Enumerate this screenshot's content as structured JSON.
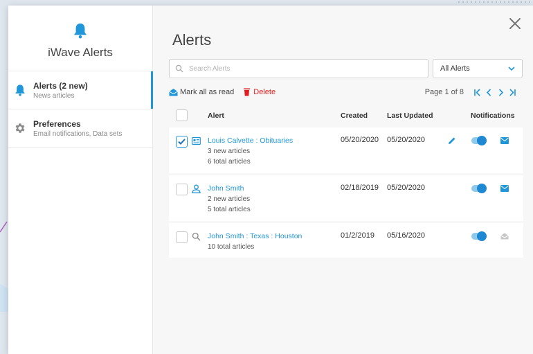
{
  "sidebar": {
    "title": "iWave Alerts",
    "items": [
      {
        "title": "Alerts (2 new)",
        "subtitle": "News articles"
      },
      {
        "title": "Preferences",
        "subtitle": "Email notifications, Data sets"
      }
    ]
  },
  "main": {
    "title": "Alerts",
    "search_placeholder": "Search Alerts",
    "filter_value": "All Alerts",
    "toolbar": {
      "mark_all_label": "Mark all as read",
      "delete_label": "Delete",
      "page_info": "Page 1 of 8"
    },
    "columns": {
      "alert": "Alert",
      "created": "Created",
      "updated": "Last Updated",
      "notifications": "Notifications"
    },
    "rows": [
      {
        "name": "Louis Calvette : Obituaries",
        "line1": "3 new articles",
        "line2": "6 total articles",
        "created": "05/20/2020",
        "updated": "05/20/2020",
        "checked": true,
        "type_icon": "profile-card-icon",
        "notifications_on": true,
        "mail_state": "unread"
      },
      {
        "name": "John Smith",
        "line1": "2 new articles",
        "line2": "5 total articles",
        "created": "02/18/2019",
        "updated": "05/20/2020",
        "checked": false,
        "type_icon": "person-icon",
        "notifications_on": true,
        "mail_state": "unread"
      },
      {
        "name": "John Smith : Texas : Houston",
        "line1": "10 total articles",
        "created": "01/2/2019",
        "updated": "05/16/2020",
        "checked": false,
        "type_icon": "search-icon",
        "notifications_on": true,
        "mail_state": "read"
      }
    ]
  },
  "colors": {
    "accent": "#2196d8",
    "delete": "#e02020",
    "toggle_track": "#8fc9ec",
    "toggle_knob": "#1e88d2"
  }
}
